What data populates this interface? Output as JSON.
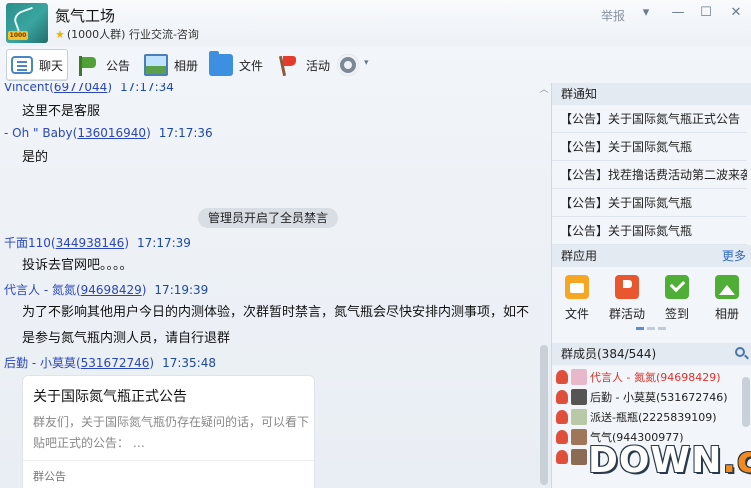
{
  "header": {
    "group_name": "氮气工场",
    "group_meta": "(1000人群) 行业交流-咨询",
    "report_label": "举报",
    "controls": [
      "▾",
      "—",
      "☐",
      "✕"
    ],
    "logo_text": "1000"
  },
  "toolbar": {
    "items": [
      {
        "label": "聊天",
        "icon": "chat-bubble-icon"
      },
      {
        "label": "公告",
        "icon": "announcement-flag-icon"
      },
      {
        "label": "相册",
        "icon": "photo-album-icon"
      },
      {
        "label": "文件",
        "icon": "folder-icon"
      },
      {
        "label": "活动",
        "icon": "activity-flag-icon"
      }
    ],
    "settings_caret": "▾"
  },
  "chat": {
    "messages": [
      {
        "sender": "Vincent",
        "qq": "6977044",
        "time": "17:17:34",
        "text": "这里不是客服"
      },
      {
        "sender": "- Oh \" Baby",
        "qq": "136016940",
        "time": "17:17:36",
        "text": "是的"
      },
      {
        "sender": "千面110",
        "qq": "344938146",
        "time": "17:17:39",
        "text": "投诉去官网吧。。。。"
      },
      {
        "sender": "代言人 - 氮氮",
        "qq": "94698429",
        "time": "17:19:39",
        "text_lines": [
          "为了不影响其他用户今日的内测体验，次群暂时禁言，氮气瓶会尽快安排内测事项，如不",
          "是参与氮气瓶内测人员，请自行退群"
        ]
      },
      {
        "sender": "后勤 - 小莫莫",
        "qq": "531672746",
        "time": "17:35:48"
      }
    ],
    "system_notice": "管理员开启了全员禁言",
    "card": {
      "title": "关于国际氮气瓶正式公告",
      "text": "群友们，关于国际氮气瓶仍存在疑问的话，可以看下贴吧正式的公告：  …",
      "tag": "群公告"
    },
    "scroll_up": "︿"
  },
  "sidebar": {
    "notice_title": "群通知",
    "notices": [
      "【公告】关于国际氮气瓶正式公告",
      "【公告】关于国际氮气瓶",
      "【公告】找茬撸话费活动第二波来袭",
      "【公告】关于国际氮气瓶",
      "【公告】关于国际氮气瓶"
    ],
    "apps_title": "群应用",
    "apps_more": "更多",
    "apps": [
      {
        "label": "文件",
        "icon": "file-app-icon",
        "color": "#f5a623"
      },
      {
        "label": "群活动",
        "icon": "group-activity-app-icon",
        "color": "#e8572d"
      },
      {
        "label": "签到",
        "icon": "check-in-app-icon",
        "color": "#4fae35"
      },
      {
        "label": "相册",
        "icon": "album-app-icon",
        "color": "#4fae35"
      }
    ],
    "members_title": "群成员(384/544)",
    "members": [
      {
        "name": "代言人 - 氮氮(94698429)",
        "color": "#e0322a"
      },
      {
        "name": "后勤 - 小莫莫(531672746)",
        "color": "#222222"
      },
      {
        "name": "派送-瓶瓶(2225839109)",
        "color": "#222222"
      },
      {
        "name": "气气(944300977)",
        "color": "#222222"
      },
      {
        "name": "蔷",
        "color": "#222222"
      }
    ]
  },
  "watermark": {
    "main": "DOWN",
    "suffix": ".cc"
  }
}
